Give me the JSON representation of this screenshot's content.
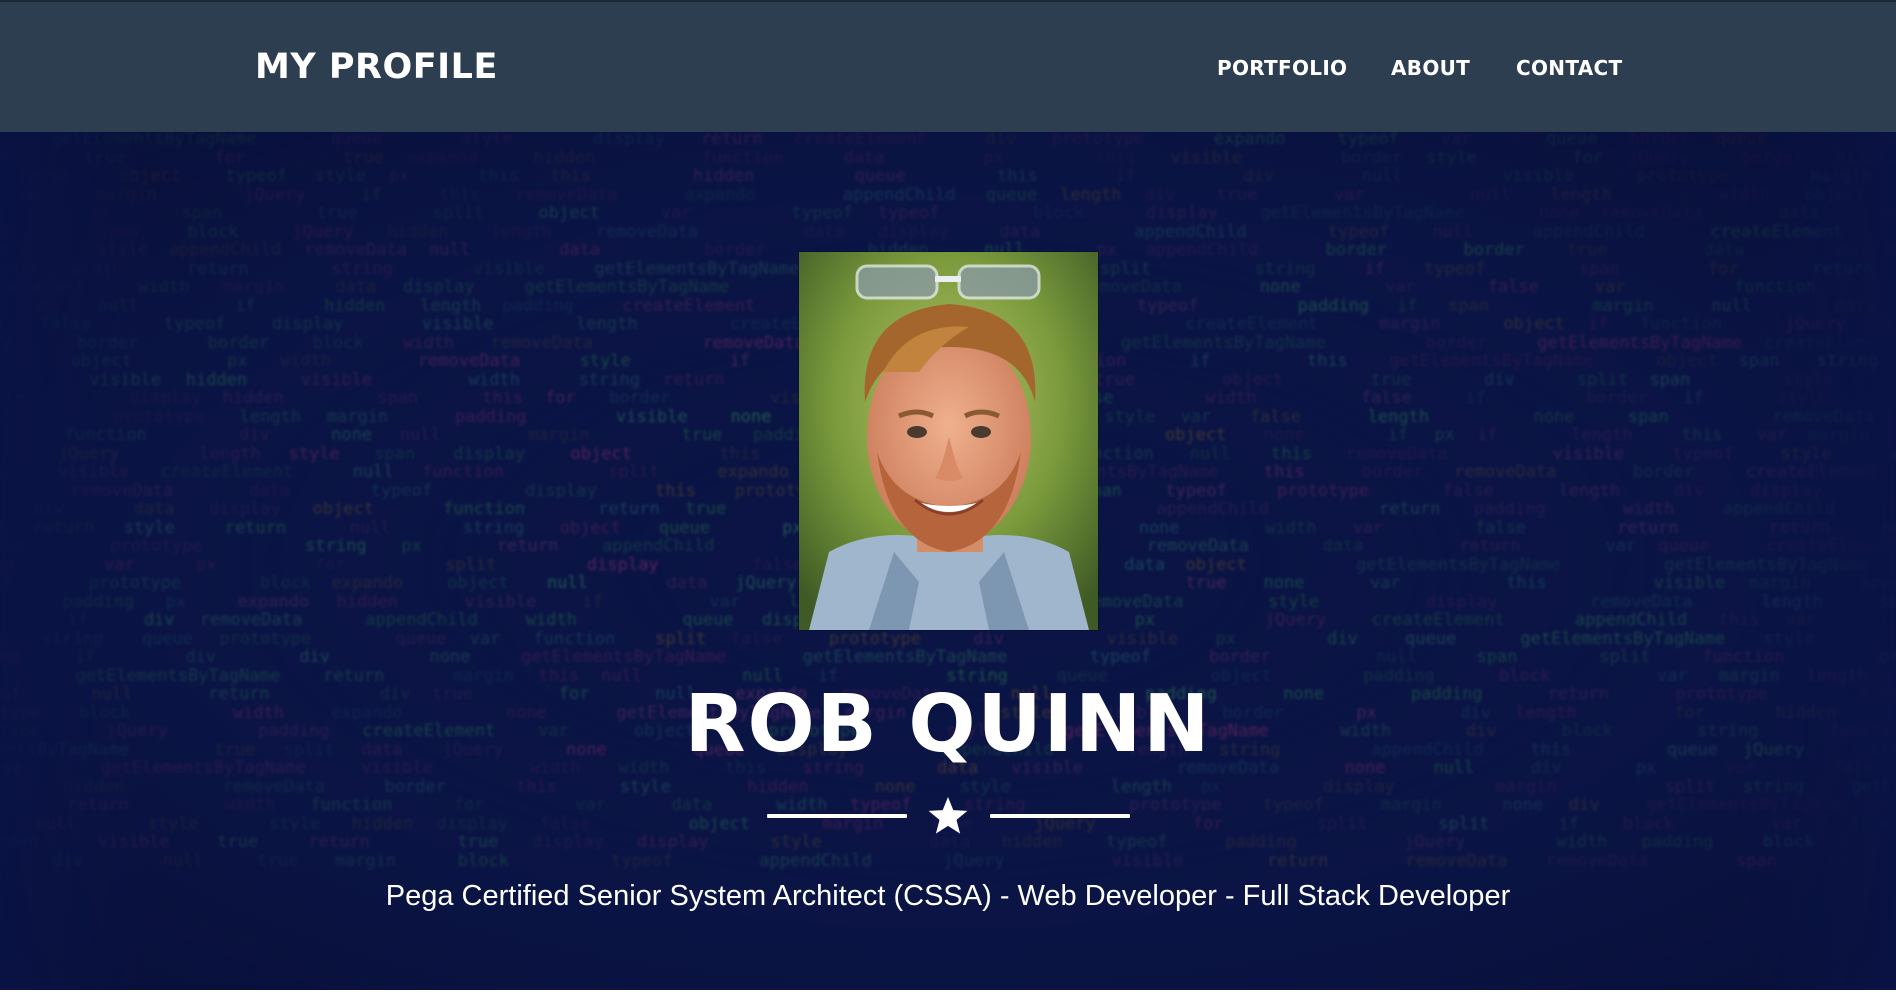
{
  "navbar": {
    "brand": "MY PROFILE",
    "links": [
      {
        "label": "PORTFOLIO"
      },
      {
        "label": "ABOUT"
      },
      {
        "label": "CONTACT"
      }
    ],
    "background": "#2c3e50"
  },
  "hero": {
    "name": "ROB QUINN",
    "tagline": "Pega Certified Senior System Architect (CSSA) - Web Developer - Full Stack Developer",
    "divider_icon": "star-icon",
    "avatar_icon": "profile-photo",
    "background": "#0b1545"
  }
}
